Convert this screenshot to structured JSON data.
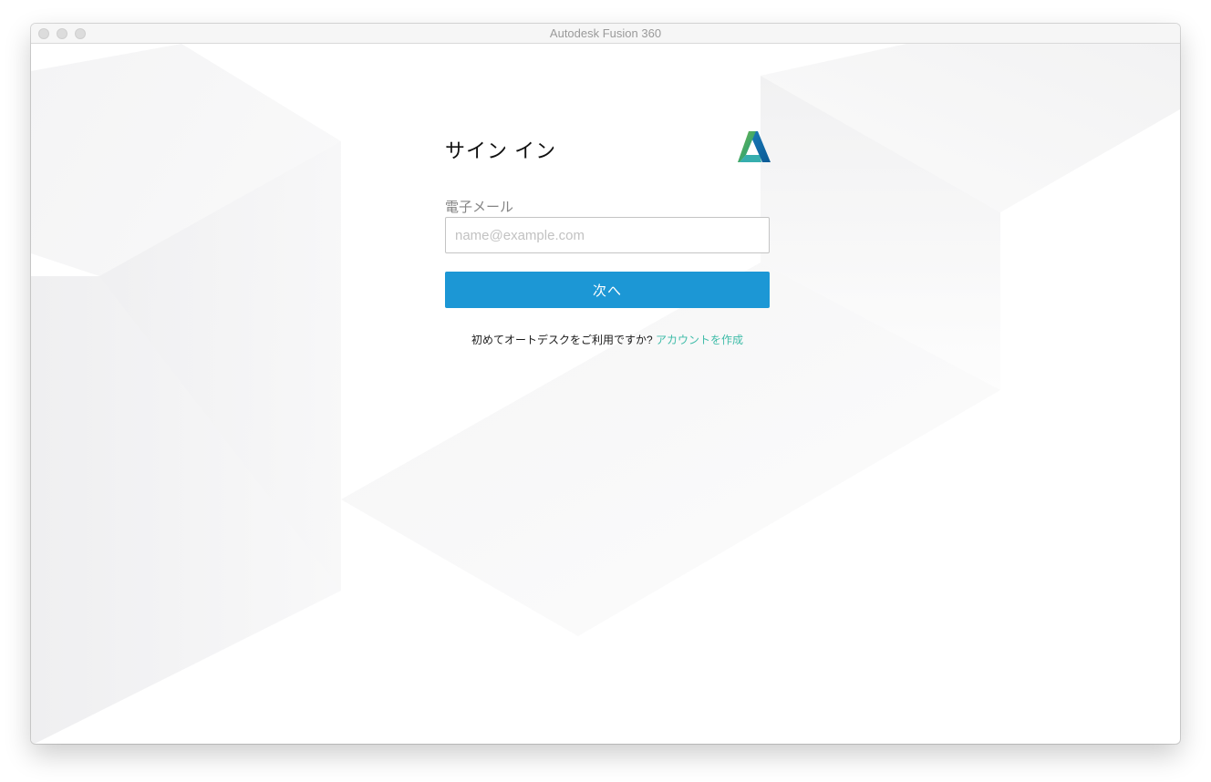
{
  "window": {
    "title": "Autodesk Fusion 360"
  },
  "signin": {
    "title": "サイン イン",
    "email_label": "電子メール",
    "email_placeholder": "name@example.com",
    "email_value": "",
    "next_label": "次へ",
    "new_user_text": "初めてオートデスクをご利用ですか?",
    "create_account_link": "アカウントを作成"
  },
  "icons": {
    "logo": "autodesk-a-logo",
    "window_controls": [
      "close-icon",
      "minimize-icon",
      "zoom-icon"
    ]
  },
  "colors": {
    "primary_button": "#1c97d5",
    "link": "#3fbca8",
    "logo_green": "#7ab648",
    "logo_blue": "#1f77bb",
    "logo_teal": "#0a9a8a"
  }
}
